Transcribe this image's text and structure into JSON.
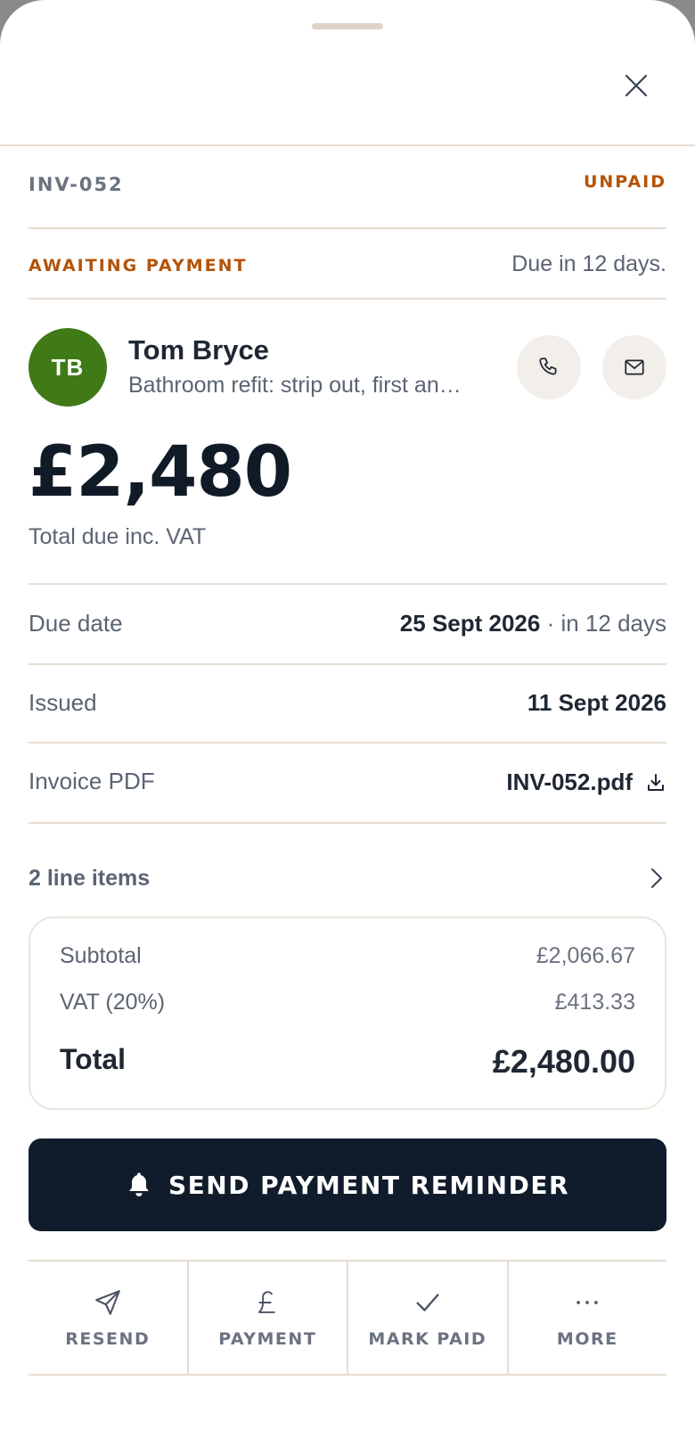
{
  "invoice": {
    "number": "INV-052",
    "status": "UNPAID",
    "payment_state": "AWAITING PAYMENT",
    "due_in": "Due in 12 days."
  },
  "customer": {
    "initials": "TB",
    "name": "Tom Bryce",
    "description": "Bathroom refit: strip out, first an…"
  },
  "amount": {
    "value": "£2,480",
    "label": "Total due inc. VAT"
  },
  "details": {
    "due_date": {
      "label": "Due date",
      "value": "25 Sept 2026",
      "sub": "· in 12 days"
    },
    "issued": {
      "label": "Issued",
      "value": "11 Sept 2026"
    },
    "pdf": {
      "label": "Invoice PDF",
      "value": "INV-052.pdf"
    }
  },
  "line_items": {
    "label": "2 line items"
  },
  "totals": {
    "subtotal_label": "Subtotal",
    "subtotal": "£2,066.67",
    "vat_label": "VAT (20%)",
    "vat": "£413.33",
    "total_label": "Total",
    "total": "£2,480.00"
  },
  "cta": {
    "label": "SEND PAYMENT REMINDER"
  },
  "actions": [
    {
      "label": "RESEND",
      "icon": "send-icon"
    },
    {
      "label": "PAYMENT",
      "icon": "pound-icon"
    },
    {
      "label": "MARK PAID",
      "icon": "check-icon"
    },
    {
      "label": "MORE",
      "icon": "more-icon"
    }
  ],
  "colors": {
    "accent": "#b45309",
    "primary": "#101c2b",
    "avatar": "#3f7a17",
    "divider": "#e6ddd2"
  }
}
